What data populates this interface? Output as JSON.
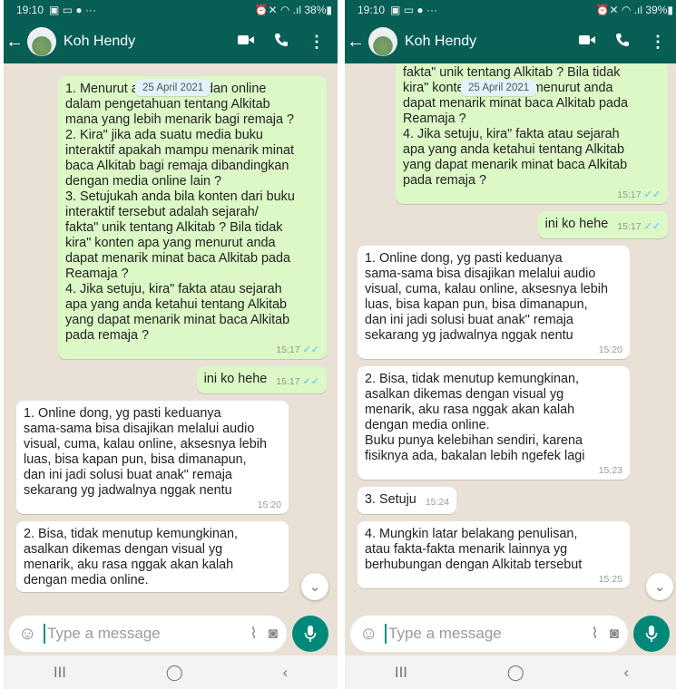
{
  "status_left": {
    "time": "19:10",
    "icons": "▣ ▭ ● ···",
    "battery": "⏰✕ ◠ .ıl 38%▮"
  },
  "status_right": {
    "time": "19:10",
    "icons": "▣ ▭ ● ···",
    "battery": "⏰✕ ◠ .ıl 39%▮"
  },
  "contact_name": "Koh Hendy",
  "date_chip": "25 April 2021",
  "icons": {
    "back": "arrow-left-icon",
    "video": "video-call-icon",
    "call": "phone-icon",
    "menu": "more-vert-icon",
    "emoji": "emoji-icon",
    "attach": "paperclip-icon",
    "camera": "camera-icon",
    "mic": "microphone-icon",
    "scroll": "chevron-double-down-icon"
  },
  "colors": {
    "header": "#075e54",
    "outgoing": "#dcf8c6",
    "incoming": "#ffffff",
    "accent": "#00897b",
    "ticks": "#4fc3f7"
  },
  "composer_placeholder": "Type a message",
  "nav": {
    "recents": "III",
    "home": "◯",
    "back": "‹"
  },
  "left_messages": [
    {
      "dir": "out",
      "text": "1. Menurut anda, offline dan online\ndalam pengetahuan tentang Alkitab\nmana yang lebih menarik bagi remaja ?\n2. Kira\" jika ada suatu media buku\ninteraktif apakah mampu menarik minat\nbaca Alkitab bagi remaja dibandingkan\ndengan media online lain ?\n3. Setujukah anda bila konten dari buku\ninteraktif tersebut adalah sejarah/\nfakta\" unik tentang Alkitab ? Bila tidak\nkira\" konten apa yang menurut anda\ndapat menarik minat baca Alkitab pada\nReamaja ?\n4. Jika setuju, kira\" fakta atau sejarah\napa yang anda ketahui tentang Alkitab\nyang dapat menarik minat baca Alkitab\npada remaja ?",
      "time": "15:17"
    },
    {
      "dir": "out",
      "text": "ini ko hehe",
      "time": "15:17"
    },
    {
      "dir": "in",
      "text": "1. Online dong, yg pasti keduanya\nsama-sama bisa disajikan melalui audio\nvisual, cuma, kalau online, aksesnya lebih\nluas, bisa kapan pun, bisa dimanapun,\ndan ini jadi solusi buat anak\" remaja\nsekarang yg jadwalnya nggak nentu",
      "time": "15:20"
    },
    {
      "dir": "in",
      "text": "2. Bisa, tidak menutup kemungkinan,\nasalkan dikemas dengan visual yg\nmenarik, aku rasa nggak akan kalah\ndengan media online.",
      "time": ""
    }
  ],
  "right_messages": [
    {
      "dir": "out",
      "text": "fakta\" unik tentang Alkitab ? Bila tidak\nkira\" konten apa yang menurut anda\ndapat menarik minat baca Alkitab pada\nReamaja ?\n4. Jika setuju, kira\" fakta atau sejarah\napa yang anda ketahui tentang Alkitab\nyang dapat menarik minat baca Alkitab\npada remaja ?",
      "time": "15:17"
    },
    {
      "dir": "out",
      "text": "ini ko hehe",
      "time": "15:17"
    },
    {
      "dir": "in",
      "text": "1. Online dong, yg pasti keduanya\nsama-sama bisa disajikan melalui audio\nvisual, cuma, kalau online, aksesnya lebih\nluas, bisa kapan pun, bisa dimanapun,\ndan ini jadi solusi buat anak\" remaja\nsekarang yg jadwalnya nggak nentu",
      "time": "15:20"
    },
    {
      "dir": "in",
      "text": "2. Bisa, tidak menutup kemungkinan,\nasalkan dikemas dengan visual yg\nmenarik, aku rasa nggak akan kalah\ndengan media online.\nBuku punya kelebihan sendiri, karena\nfisiknya ada, bakalan lebih ngefek lagi",
      "time": "15:23"
    },
    {
      "dir": "in",
      "text": "3. Setuju",
      "time": "15:24"
    },
    {
      "dir": "in",
      "text": "4. Mungkin latar belakang penulisan,\natau fakta-fakta menarik lainnya yg\nberhubungan dengan Alkitab tersebut",
      "time": "15:25"
    }
  ]
}
